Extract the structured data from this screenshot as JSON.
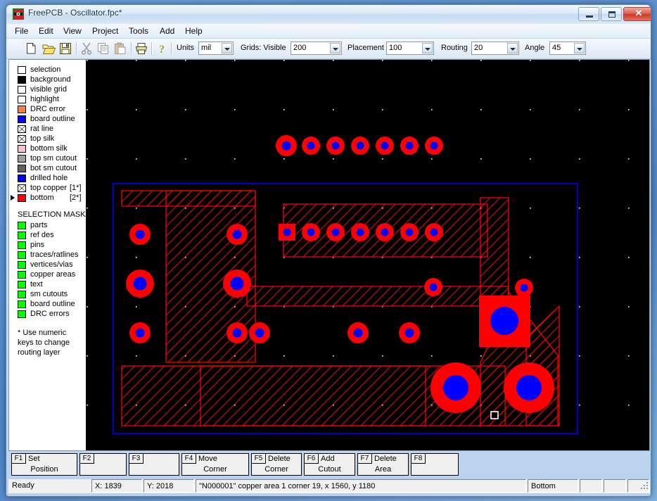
{
  "window": {
    "title": "FreePCB - Oscillator.fpc*",
    "icon": "freepcb-app-icon",
    "buttons": {
      "minimize": "minimize",
      "maximize": "maximize",
      "close": "close"
    }
  },
  "menubar": {
    "items": [
      "File",
      "Edit",
      "View",
      "Project",
      "Tools",
      "Add",
      "Help"
    ]
  },
  "toolbar": {
    "icons": [
      "new-file-icon",
      "open-folder-icon",
      "save-disk-icon",
      "cut-scissors-icon",
      "copy-icon",
      "paste-icon",
      "print-icon",
      "help-question-icon"
    ],
    "fields": [
      {
        "label": "Units",
        "value": "mil",
        "name": "units-combo"
      },
      {
        "label": "Grids: Visible",
        "value": "200",
        "name": "visible-grid-combo"
      },
      {
        "label": "Placement",
        "value": "100",
        "name": "placement-grid-combo"
      },
      {
        "label": "Routing",
        "value": "20",
        "name": "routing-grid-combo"
      },
      {
        "label": "Angle",
        "value": "45",
        "name": "angle-combo"
      }
    ]
  },
  "sidebar": {
    "layers": [
      {
        "label": "selection",
        "color": "#ffffff",
        "hatch": false,
        "num": ""
      },
      {
        "label": "background",
        "color": "#000000",
        "hatch": false,
        "num": ""
      },
      {
        "label": "visible grid",
        "color": "#ffffff",
        "hatch": false,
        "num": ""
      },
      {
        "label": "highlight",
        "color": "#ffffff",
        "hatch": false,
        "num": ""
      },
      {
        "label": "DRC error",
        "color": "#ff8040",
        "hatch": false,
        "num": ""
      },
      {
        "label": "board outline",
        "color": "#0000ff",
        "hatch": false,
        "num": ""
      },
      {
        "label": "rat line",
        "color": "#ffffff",
        "hatch": true,
        "num": ""
      },
      {
        "label": "top silk",
        "color": "#ffffff",
        "hatch": true,
        "num": ""
      },
      {
        "label": "bottom silk",
        "color": "#ffc0cb",
        "hatch": false,
        "num": ""
      },
      {
        "label": "top sm cutout",
        "color": "#a0a0a0",
        "hatch": false,
        "num": ""
      },
      {
        "label": "bot sm cutout",
        "color": "#606060",
        "hatch": false,
        "num": ""
      },
      {
        "label": "drilled hole",
        "color": "#0000ff",
        "hatch": false,
        "num": ""
      },
      {
        "label": "top copper",
        "color": "#ffffff",
        "hatch": true,
        "num": "[1*]"
      },
      {
        "label": "bottom",
        "color": "#ff0000",
        "hatch": false,
        "num": "[2*]",
        "active": true
      }
    ],
    "mask_title": "SELECTION MASK",
    "mask_color": "#00ff00",
    "mask_items": [
      "parts",
      "ref des",
      "pins",
      "traces/ratlines",
      "vertices/vias",
      "copper areas",
      "text",
      "sm cutouts",
      "board outline",
      "DRC errors"
    ],
    "note": "* Use numeric\nkeys to change\nrouting layer"
  },
  "canvas": {
    "background": "#000000",
    "grid_dot_color": "#ffffff",
    "board_outline_color": "#0000ff",
    "copper_color": "#ff0000",
    "hole_color": "#0000ff",
    "selection_color": "#ffffff",
    "grid_spacing_px": 70
  },
  "fkeys": [
    {
      "key": "F1",
      "line1": "Set",
      "line2": "Position"
    },
    {
      "key": "F2",
      "line1": "",
      "line2": ""
    },
    {
      "key": "F3",
      "line1": "",
      "line2": ""
    },
    {
      "key": "F4",
      "line1": "Move",
      "line2": "Corner"
    },
    {
      "key": "F5",
      "line1": "Delete",
      "line2": "Corner"
    },
    {
      "key": "F6",
      "line1": "Add",
      "line2": "Cutout"
    },
    {
      "key": "F7",
      "line1": "Delete",
      "line2": "Area"
    },
    {
      "key": "F8",
      "line1": "",
      "line2": ""
    }
  ],
  "statusbar": {
    "ready": "Ready",
    "x": "X: 1839",
    "y": "Y: 2018",
    "message": "\"N000001\" copper area 1 corner 19, x 1560, y 1180",
    "layer": "Bottom"
  }
}
